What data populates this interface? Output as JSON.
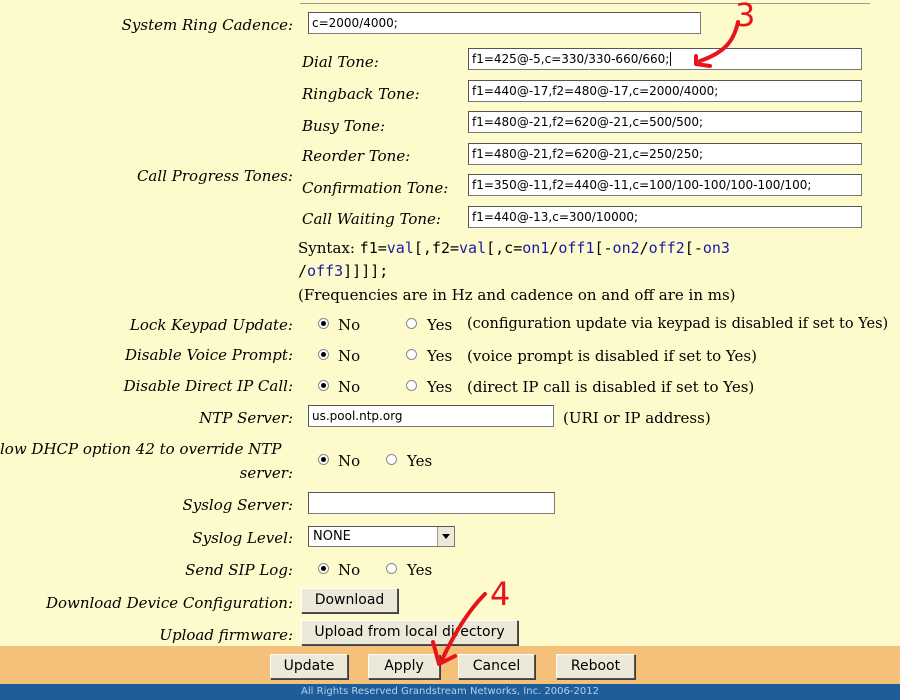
{
  "rows": {
    "system_ring_cadence": {
      "label": "System Ring Cadence:",
      "value": "c=2000/4000;"
    },
    "call_progress_tones": {
      "label": "Call Progress Tones:"
    },
    "tones": [
      {
        "label": "Dial Tone:",
        "value": "f1=425@-5,c=330/330-660/660;"
      },
      {
        "label": "Ringback Tone:",
        "value": "f1=440@-17,f2=480@-17,c=2000/4000;"
      },
      {
        "label": "Busy Tone:",
        "value": "f1=480@-21,f2=620@-21,c=500/500;"
      },
      {
        "label": "Reorder Tone:",
        "value": "f1=480@-21,f2=620@-21,c=250/250;"
      },
      {
        "label": "Confirmation Tone:",
        "value": "f1=350@-11,f2=440@-11,c=100/100-100/100-100/100;"
      },
      {
        "label": "Call Waiting Tone:",
        "value": "f1=440@-13,c=300/10000;"
      }
    ],
    "syntax": {
      "prefix": "Syntax: ",
      "parts": [
        "f1=",
        "val",
        "[,f2=",
        "val",
        "[,c=",
        "on1",
        "/",
        "off1",
        "[-",
        "on2",
        "/",
        "off2",
        "[-",
        "on3"
      ],
      "line2": [
        "/",
        "off3",
        "]]]];"
      ],
      "note": "(Frequencies are in Hz and cadence on and off are in ms)"
    },
    "lock_keypad": {
      "label": "Lock Keypad Update:",
      "no": "No",
      "yes": "Yes",
      "note": "(configuration update via keypad is disabled if set to Yes)",
      "selected": "No"
    },
    "disable_voice": {
      "label": "Disable Voice Prompt:",
      "no": "No",
      "yes": "Yes",
      "note": "(voice prompt is disabled if set to Yes)",
      "selected": "No"
    },
    "disable_direct_ip": {
      "label": "Disable Direct IP Call:",
      "no": "No",
      "yes": "Yes",
      "note": "(direct IP call is disabled if set to Yes)",
      "selected": "No"
    },
    "ntp_server": {
      "label": "NTP Server:",
      "value": "us.pool.ntp.org",
      "note": "(URI or IP address)"
    },
    "dhcp42": {
      "label_line1": "low DHCP option 42 to override NTP",
      "label_line2": "server:",
      "no": "No",
      "yes": "Yes",
      "selected": "No"
    },
    "syslog_server": {
      "label": "Syslog Server:",
      "value": ""
    },
    "syslog_level": {
      "label": "Syslog Level:",
      "value": "NONE"
    },
    "send_sip_log": {
      "label": "Send SIP Log:",
      "no": "No",
      "yes": "Yes",
      "selected": "No"
    },
    "download_config": {
      "label": "Download Device Configuration:",
      "button": "Download"
    },
    "upload_firmware": {
      "label": "Upload firmware:",
      "button": "Upload from local directory"
    }
  },
  "footer": {
    "buttons": {
      "update": "Update",
      "apply": "Apply",
      "cancel": "Cancel",
      "reboot": "Reboot"
    },
    "copyright": "All Rights Reserved Grandstream Networks, Inc. 2006-2012"
  },
  "annotations": {
    "step3": "3",
    "step4": "4"
  },
  "colors": {
    "page_bg": "#fdfbcb",
    "button_bar": "#f5c07a",
    "footer_bar": "#1d5d99",
    "annotation": "#e8141c"
  }
}
